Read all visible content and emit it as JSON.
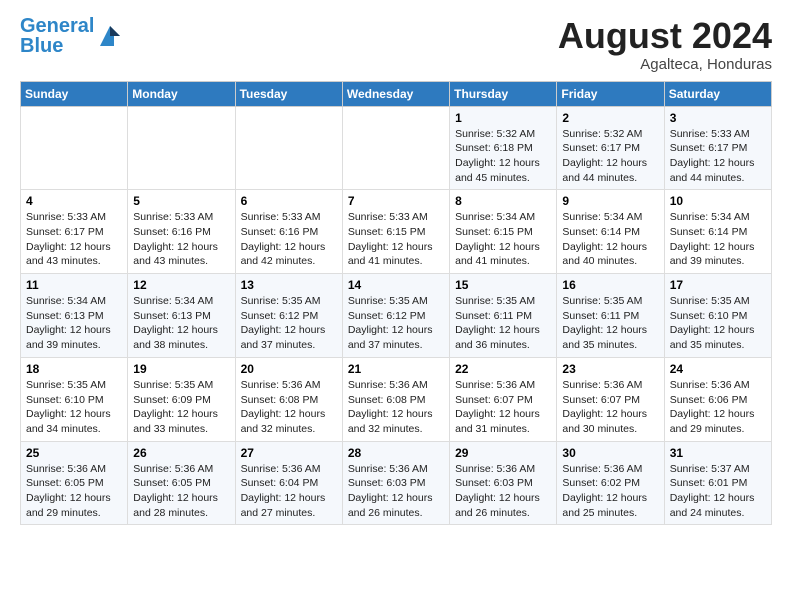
{
  "header": {
    "logo_line1": "General",
    "logo_line2": "Blue",
    "title": "August 2024",
    "subtitle": "Agalteca, Honduras"
  },
  "calendar": {
    "days_of_week": [
      "Sunday",
      "Monday",
      "Tuesday",
      "Wednesday",
      "Thursday",
      "Friday",
      "Saturday"
    ],
    "weeks": [
      [
        {
          "day": "",
          "info": ""
        },
        {
          "day": "",
          "info": ""
        },
        {
          "day": "",
          "info": ""
        },
        {
          "day": "",
          "info": ""
        },
        {
          "day": "1",
          "info": "Sunrise: 5:32 AM\nSunset: 6:18 PM\nDaylight: 12 hours\nand 45 minutes."
        },
        {
          "day": "2",
          "info": "Sunrise: 5:32 AM\nSunset: 6:17 PM\nDaylight: 12 hours\nand 44 minutes."
        },
        {
          "day": "3",
          "info": "Sunrise: 5:33 AM\nSunset: 6:17 PM\nDaylight: 12 hours\nand 44 minutes."
        }
      ],
      [
        {
          "day": "4",
          "info": "Sunrise: 5:33 AM\nSunset: 6:17 PM\nDaylight: 12 hours\nand 43 minutes."
        },
        {
          "day": "5",
          "info": "Sunrise: 5:33 AM\nSunset: 6:16 PM\nDaylight: 12 hours\nand 43 minutes."
        },
        {
          "day": "6",
          "info": "Sunrise: 5:33 AM\nSunset: 6:16 PM\nDaylight: 12 hours\nand 42 minutes."
        },
        {
          "day": "7",
          "info": "Sunrise: 5:33 AM\nSunset: 6:15 PM\nDaylight: 12 hours\nand 41 minutes."
        },
        {
          "day": "8",
          "info": "Sunrise: 5:34 AM\nSunset: 6:15 PM\nDaylight: 12 hours\nand 41 minutes."
        },
        {
          "day": "9",
          "info": "Sunrise: 5:34 AM\nSunset: 6:14 PM\nDaylight: 12 hours\nand 40 minutes."
        },
        {
          "day": "10",
          "info": "Sunrise: 5:34 AM\nSunset: 6:14 PM\nDaylight: 12 hours\nand 39 minutes."
        }
      ],
      [
        {
          "day": "11",
          "info": "Sunrise: 5:34 AM\nSunset: 6:13 PM\nDaylight: 12 hours\nand 39 minutes."
        },
        {
          "day": "12",
          "info": "Sunrise: 5:34 AM\nSunset: 6:13 PM\nDaylight: 12 hours\nand 38 minutes."
        },
        {
          "day": "13",
          "info": "Sunrise: 5:35 AM\nSunset: 6:12 PM\nDaylight: 12 hours\nand 37 minutes."
        },
        {
          "day": "14",
          "info": "Sunrise: 5:35 AM\nSunset: 6:12 PM\nDaylight: 12 hours\nand 37 minutes."
        },
        {
          "day": "15",
          "info": "Sunrise: 5:35 AM\nSunset: 6:11 PM\nDaylight: 12 hours\nand 36 minutes."
        },
        {
          "day": "16",
          "info": "Sunrise: 5:35 AM\nSunset: 6:11 PM\nDaylight: 12 hours\nand 35 minutes."
        },
        {
          "day": "17",
          "info": "Sunrise: 5:35 AM\nSunset: 6:10 PM\nDaylight: 12 hours\nand 35 minutes."
        }
      ],
      [
        {
          "day": "18",
          "info": "Sunrise: 5:35 AM\nSunset: 6:10 PM\nDaylight: 12 hours\nand 34 minutes."
        },
        {
          "day": "19",
          "info": "Sunrise: 5:35 AM\nSunset: 6:09 PM\nDaylight: 12 hours\nand 33 minutes."
        },
        {
          "day": "20",
          "info": "Sunrise: 5:36 AM\nSunset: 6:08 PM\nDaylight: 12 hours\nand 32 minutes."
        },
        {
          "day": "21",
          "info": "Sunrise: 5:36 AM\nSunset: 6:08 PM\nDaylight: 12 hours\nand 32 minutes."
        },
        {
          "day": "22",
          "info": "Sunrise: 5:36 AM\nSunset: 6:07 PM\nDaylight: 12 hours\nand 31 minutes."
        },
        {
          "day": "23",
          "info": "Sunrise: 5:36 AM\nSunset: 6:07 PM\nDaylight: 12 hours\nand 30 minutes."
        },
        {
          "day": "24",
          "info": "Sunrise: 5:36 AM\nSunset: 6:06 PM\nDaylight: 12 hours\nand 29 minutes."
        }
      ],
      [
        {
          "day": "25",
          "info": "Sunrise: 5:36 AM\nSunset: 6:05 PM\nDaylight: 12 hours\nand 29 minutes."
        },
        {
          "day": "26",
          "info": "Sunrise: 5:36 AM\nSunset: 6:05 PM\nDaylight: 12 hours\nand 28 minutes."
        },
        {
          "day": "27",
          "info": "Sunrise: 5:36 AM\nSunset: 6:04 PM\nDaylight: 12 hours\nand 27 minutes."
        },
        {
          "day": "28",
          "info": "Sunrise: 5:36 AM\nSunset: 6:03 PM\nDaylight: 12 hours\nand 26 minutes."
        },
        {
          "day": "29",
          "info": "Sunrise: 5:36 AM\nSunset: 6:03 PM\nDaylight: 12 hours\nand 26 minutes."
        },
        {
          "day": "30",
          "info": "Sunrise: 5:36 AM\nSunset: 6:02 PM\nDaylight: 12 hours\nand 25 minutes."
        },
        {
          "day": "31",
          "info": "Sunrise: 5:37 AM\nSunset: 6:01 PM\nDaylight: 12 hours\nand 24 minutes."
        }
      ]
    ]
  }
}
